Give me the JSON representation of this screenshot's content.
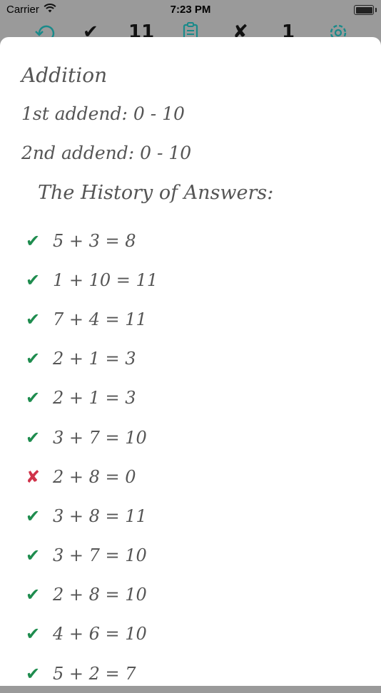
{
  "status_bar": {
    "carrier": "Carrier",
    "time": "7:23 PM"
  },
  "toolbar": {
    "correct_count": "11",
    "wrong_count": "1",
    "correct_icon": "check-icon",
    "wrong_icon": "cross-icon",
    "undo_icon": "undo-icon",
    "clipboard_icon": "clipboard-list-icon",
    "settings_icon": "gear-icon",
    "accent_color": "#1a8a8a"
  },
  "sheet": {
    "title": "Addition",
    "addend1": "1st addend: 0 - 10",
    "addend2": "2nd addend: 0 - 10",
    "history_title": "The History of Answers:"
  },
  "history": [
    {
      "status": "correct",
      "mark": "✔",
      "text": "5 + 3 = 8"
    },
    {
      "status": "correct",
      "mark": "✔",
      "text": "1 + 10 = 11"
    },
    {
      "status": "correct",
      "mark": "✔",
      "text": "7 + 4 = 11"
    },
    {
      "status": "correct",
      "mark": "✔",
      "text": "2 + 1 = 3"
    },
    {
      "status": "correct",
      "mark": "✔",
      "text": "2 + 1 = 3"
    },
    {
      "status": "correct",
      "mark": "✔",
      "text": "3 + 7 = 10"
    },
    {
      "status": "wrong",
      "mark": "✘",
      "text": "2 + 8 = 0"
    },
    {
      "status": "correct",
      "mark": "✔",
      "text": "3 + 8 = 11"
    },
    {
      "status": "correct",
      "mark": "✔",
      "text": "3 + 7 = 10"
    },
    {
      "status": "correct",
      "mark": "✔",
      "text": "2 + 8 = 10"
    },
    {
      "status": "correct",
      "mark": "✔",
      "text": "4 + 6 = 10"
    },
    {
      "status": "correct",
      "mark": "✔",
      "text": "5 + 2 = 7"
    }
  ]
}
